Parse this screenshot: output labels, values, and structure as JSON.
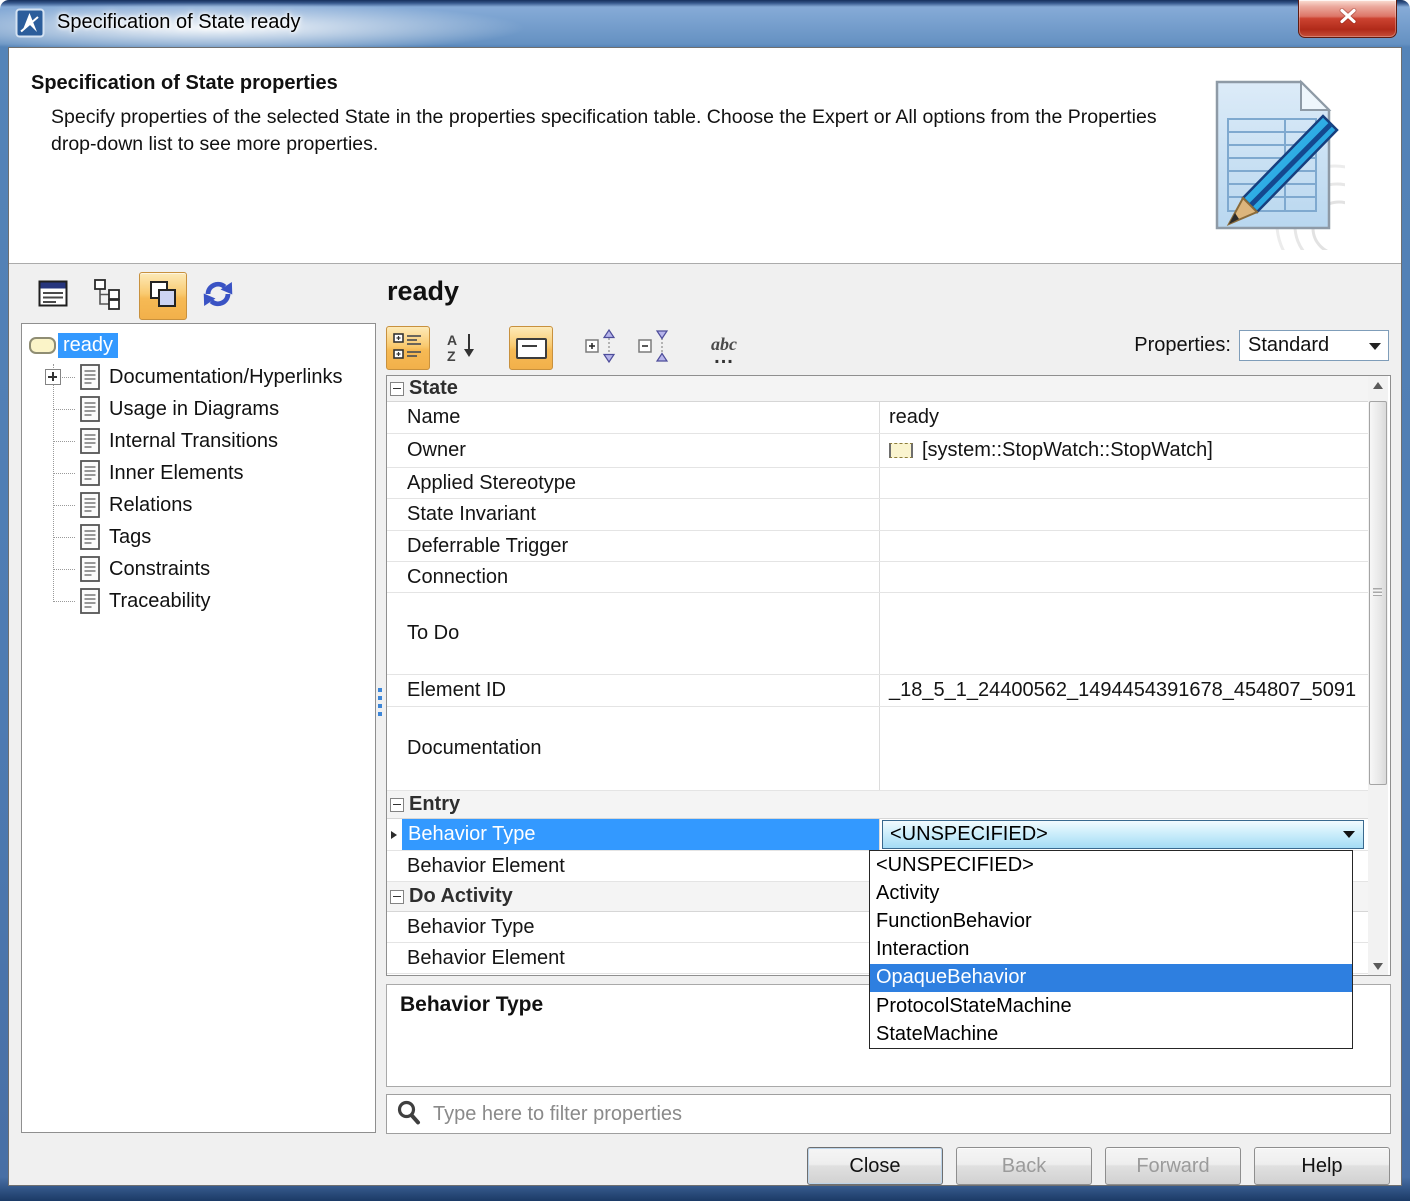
{
  "window": {
    "title": "Specification of State ready"
  },
  "header": {
    "title": "Specification of State properties",
    "description": "Specify properties of the selected State in the properties specification table. Choose the Expert or All options from the Properties drop-down list to see more properties."
  },
  "tree": {
    "root": {
      "label": "ready",
      "selected": true
    },
    "items": [
      {
        "label": "Documentation/Hyperlinks",
        "expandable": true
      },
      {
        "label": "Usage in Diagrams"
      },
      {
        "label": "Internal Transitions"
      },
      {
        "label": "Inner Elements"
      },
      {
        "label": "Relations"
      },
      {
        "label": "Tags"
      },
      {
        "label": "Constraints"
      },
      {
        "label": "Traceability"
      }
    ]
  },
  "main": {
    "node_title": "ready",
    "properties_label": "Properties:",
    "properties_mode": "Standard",
    "description_panel_title": "Behavior Type",
    "filter_placeholder": "Type here to filter properties"
  },
  "table": {
    "rows": [
      {
        "type": "section",
        "label": "State"
      },
      {
        "label": "Name",
        "value": "ready"
      },
      {
        "label": "Owner",
        "value": "[system::StopWatch::StopWatch]"
      },
      {
        "label": "Applied Stereotype",
        "value": ""
      },
      {
        "label": "State Invariant",
        "value": ""
      },
      {
        "label": "Deferrable Trigger",
        "value": ""
      },
      {
        "label": "Connection",
        "value": ""
      },
      {
        "label": "To Do",
        "value": ""
      },
      {
        "label": "Element ID",
        "value": "_18_5_1_24400562_1494454391678_454807_5091"
      },
      {
        "label": "Documentation",
        "value": ""
      },
      {
        "type": "section",
        "label": "Entry"
      },
      {
        "label": "Behavior Type",
        "selected": true
      },
      {
        "label": "Behavior Element",
        "value": ""
      },
      {
        "type": "section",
        "label": "Do Activity"
      },
      {
        "label": "Behavior Type",
        "value": ""
      },
      {
        "label": "Behavior Element",
        "value": ""
      }
    ]
  },
  "dropdown": {
    "value": "<UNSPECIFIED>",
    "options": [
      "<UNSPECIFIED>",
      "Activity",
      "FunctionBehavior",
      "Interaction",
      "OpaqueBehavior",
      "ProtocolStateMachine",
      "StateMachine"
    ],
    "highlighted_option": "OpaqueBehavior"
  },
  "footer": {
    "buttons": [
      {
        "label": "Close",
        "enabled": true
      },
      {
        "label": "Back",
        "enabled": false
      },
      {
        "label": "Forward",
        "enabled": false
      },
      {
        "label": "Help",
        "enabled": true
      }
    ]
  },
  "icons": {
    "sort_a": "A",
    "sort_z": "Z",
    "abc_text": "abc",
    "abc_dots": "..."
  },
  "colors": {
    "selection_blue": "#3399ff",
    "dropdown_highlight": "#2e7fe0",
    "toolbar_selected_orange": "#f6ba55",
    "titlebar_blue": "#5584b8",
    "close_button_red": "#cc4331",
    "muted_text": "#9b9b9b"
  }
}
